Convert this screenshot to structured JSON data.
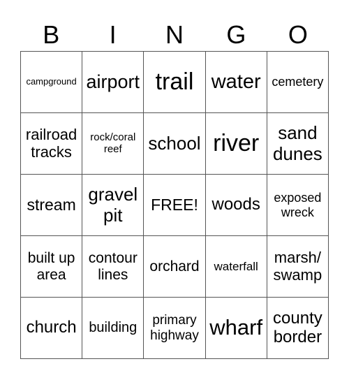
{
  "header": [
    "B",
    "I",
    "N",
    "G",
    "O"
  ],
  "cells": [
    {
      "text": "campground",
      "size": 13
    },
    {
      "text": "airport",
      "size": 27
    },
    {
      "text": "trail",
      "size": 34
    },
    {
      "text": "water",
      "size": 29
    },
    {
      "text": "cemetery",
      "size": 18
    },
    {
      "text": "railroad\ntracks",
      "size": 22
    },
    {
      "text": "rock/coral\nreef",
      "size": 15
    },
    {
      "text": "school",
      "size": 26
    },
    {
      "text": "river",
      "size": 34
    },
    {
      "text": "sand\ndunes",
      "size": 26
    },
    {
      "text": "stream",
      "size": 23
    },
    {
      "text": "gravel\npit",
      "size": 26
    },
    {
      "text": "FREE!",
      "size": 23
    },
    {
      "text": "woods",
      "size": 24
    },
    {
      "text": "exposed\nwreck",
      "size": 18
    },
    {
      "text": "built up\narea",
      "size": 21
    },
    {
      "text": "contour\nlines",
      "size": 21
    },
    {
      "text": "orchard",
      "size": 21
    },
    {
      "text": "waterfall",
      "size": 17
    },
    {
      "text": "marsh/\nswamp",
      "size": 22
    },
    {
      "text": "church",
      "size": 24
    },
    {
      "text": "building",
      "size": 20
    },
    {
      "text": "primary\nhighway",
      "size": 19
    },
    {
      "text": "wharf",
      "size": 31
    },
    {
      "text": "county\nborder",
      "size": 24
    }
  ]
}
